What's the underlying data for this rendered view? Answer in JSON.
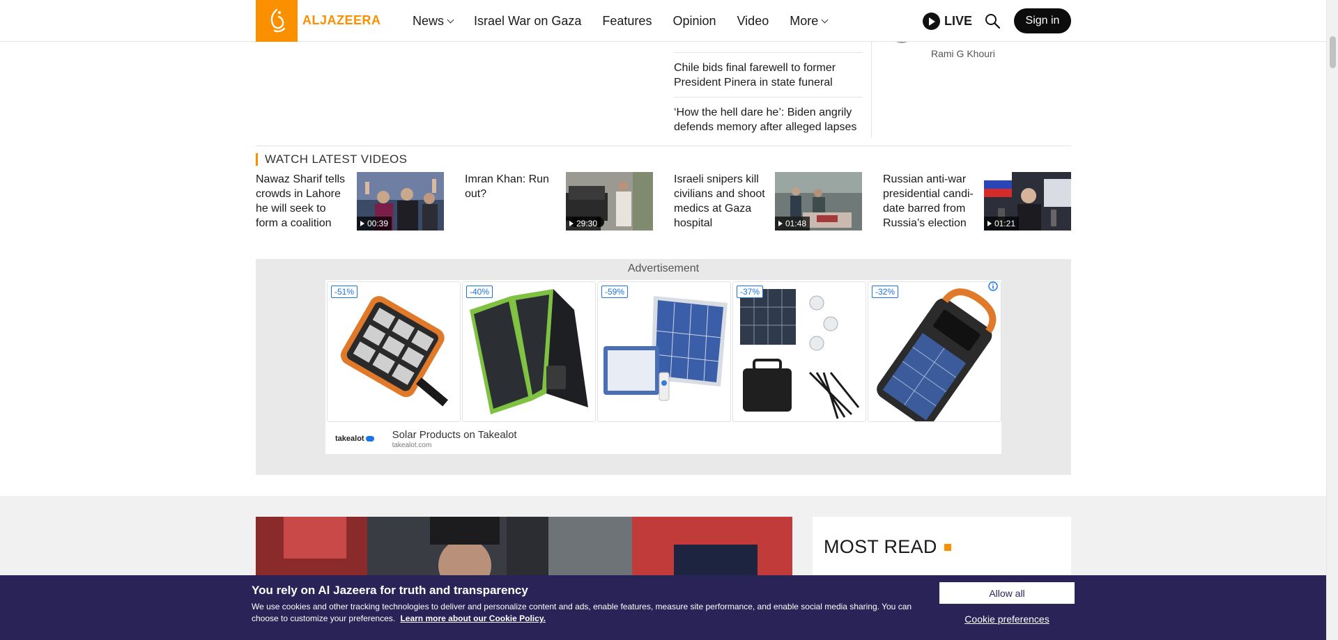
{
  "header": {
    "logo_text": "ALJAZEERA",
    "nav": [
      {
        "label": "News",
        "has_dropdown": true
      },
      {
        "label": "Israel War on Gaza",
        "has_dropdown": false
      },
      {
        "label": "Features",
        "has_dropdown": false
      },
      {
        "label": "Opinion",
        "has_dropdown": false
      },
      {
        "label": "Video",
        "has_dropdown": false
      },
      {
        "label": "More",
        "has_dropdown": true
      }
    ],
    "live_label": "LIVE",
    "signin_label": "Sign in",
    "brand_color": "#fa9000"
  },
  "top_headlines": [
    "Chile bids final farewell to former President Pinera in state funeral",
    "‘How the hell dare he’: Biden angrily defends memory after alleged lapses"
  ],
  "opinion_author": "Rami G Khouri",
  "videos": {
    "heading": "WATCH LATEST VIDEOS",
    "items": [
      {
        "title": "Nawaz Sharif tells crowds in Lahore he will seek to form a coalition",
        "duration": "00:39"
      },
      {
        "title": "Imran Khan: Run out?",
        "duration": "29:30"
      },
      {
        "title": "Israeli snipers kill civilians and shoot medics at Gaza hospital",
        "duration": "01:48"
      },
      {
        "title": "Russian anti-war presidential candi-date barred from Russia’s election",
        "duration": "01:21"
      }
    ]
  },
  "advertisement": {
    "label": "Advertisement",
    "discounts": [
      "-51%",
      "-40%",
      "-59%",
      "-37%",
      "-32%"
    ],
    "advertiser_logo": "takealot",
    "title": "Solar Products on Takealot",
    "domain": "takealot.com"
  },
  "most_read": {
    "title": "MOST READ"
  },
  "cookie_banner": {
    "title": "You rely on Al Jazeera for truth and transparency",
    "text": "We use cookies and other tracking technologies to deliver and personalize content and ads, enable features, measure site performance, and enable social media sharing. You can choose to customize your preferences.",
    "link": "Learn more about our Cookie Policy.",
    "allow_all": "Allow all",
    "preferences": "Cookie preferences",
    "background_color": "#2a2357"
  }
}
